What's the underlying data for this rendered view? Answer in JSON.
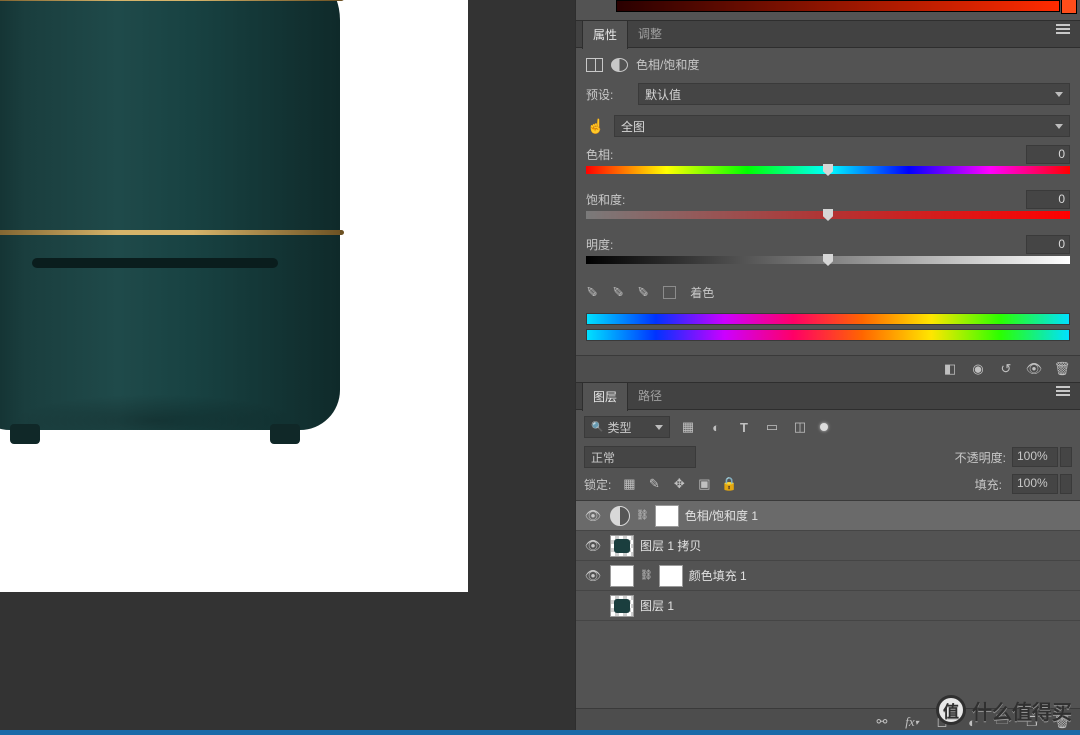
{
  "properties_panel": {
    "tabs": {
      "properties": "属性",
      "adjustments": "调整"
    },
    "adjustment_type": "色相/饱和度",
    "preset": {
      "label": "预设:",
      "value": "默认值"
    },
    "scope": {
      "value": "全图"
    },
    "hue": {
      "label": "色相:",
      "value": "0",
      "pos_pct": 50
    },
    "saturation": {
      "label": "饱和度:",
      "value": "0",
      "pos_pct": 50
    },
    "lightness": {
      "label": "明度:",
      "value": "0",
      "pos_pct": 50
    },
    "colorize_label": "着色"
  },
  "layers_panel": {
    "tabs": {
      "layers": "图层",
      "paths": "路径"
    },
    "filter_kind": "类型",
    "blend_mode": "正常",
    "opacity": {
      "label": "不透明度:",
      "value": "100%"
    },
    "lock_label": "锁定:",
    "fill": {
      "label": "填充:",
      "value": "100%"
    },
    "layers": [
      {
        "name": "色相/饱和度 1",
        "selected": true,
        "visible": true,
        "kind": "adj-hue"
      },
      {
        "name": "图层 1 拷贝",
        "selected": false,
        "visible": true,
        "kind": "pixel"
      },
      {
        "name": "颜色填充 1",
        "selected": false,
        "visible": true,
        "kind": "adj-fill"
      },
      {
        "name": "图层 1",
        "selected": false,
        "visible": false,
        "kind": "pixel"
      }
    ]
  },
  "watermark": "什么值得买"
}
